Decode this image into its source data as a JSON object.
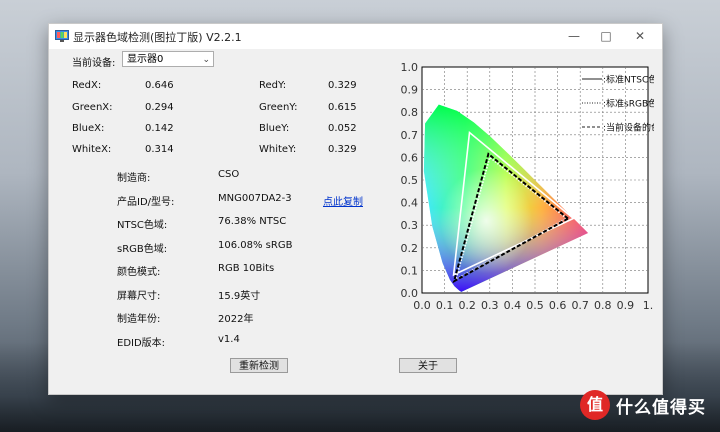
{
  "window": {
    "title": "显示器色域检测(图拉丁版) V2.2.1",
    "minimize_icon": "minimize-icon",
    "maximize_icon": "maximize-icon",
    "close_icon": "close-icon"
  },
  "device": {
    "label": "当前设备:",
    "selected": "显示器0"
  },
  "coords": {
    "redx_label": "RedX:",
    "redx": "0.646",
    "redy_label": "RedY:",
    "redy": "0.329",
    "greenx_label": "GreenX:",
    "greenx": "0.294",
    "greeny_label": "GreenY:",
    "greeny": "0.615",
    "bluex_label": "BlueX:",
    "bluex": "0.142",
    "bluey_label": "BlueY:",
    "bluey": "0.052",
    "whitex_label": "WhiteX:",
    "whitex": "0.314",
    "whitey_label": "WhiteY:",
    "whitey": "0.329"
  },
  "info": [
    {
      "label": "制造商:",
      "value": "CSO"
    },
    {
      "label": "产品ID/型号:",
      "value": "MNG007DA2-3"
    },
    {
      "label": "NTSC色域:",
      "value": "76.38% NTSC"
    },
    {
      "label": "sRGB色域:",
      "value": "106.08% sRGB"
    },
    {
      "label": "颜色模式:",
      "value": "RGB 10Bits"
    },
    {
      "label": "屏幕尺寸:",
      "value": "15.9英寸"
    },
    {
      "label": "制造年份:",
      "value": "2022年"
    },
    {
      "label": "EDID版本:",
      "value": "v1.4"
    }
  ],
  "copy_link": "点此复制",
  "buttons": {
    "redetect": "重新检测",
    "about": "关于"
  },
  "chart_data": {
    "type": "scatter",
    "xlim": [
      0.0,
      1.0
    ],
    "ylim": [
      0.0,
      1.0
    ],
    "x_ticks": [
      "0.0",
      "0.1",
      "0.2",
      "0.3",
      "0.4",
      "0.5",
      "0.6",
      "0.7",
      "0.8",
      "0.9",
      "1."
    ],
    "y_ticks": [
      "0.0",
      "0.1",
      "0.2",
      "0.3",
      "0.4",
      "0.5",
      "0.6",
      "0.7",
      "0.8",
      "0.9",
      "1.0"
    ],
    "grid": true,
    "legend_position": "top-right",
    "series": [
      {
        "name": "标准NTSC色彩范围",
        "style": "solid",
        "color": "#ffffff",
        "points": [
          [
            0.67,
            0.33
          ],
          [
            0.21,
            0.71
          ],
          [
            0.14,
            0.08
          ]
        ]
      },
      {
        "name": "标准sRGB色彩范围",
        "style": "dotted",
        "color": "#ffffff",
        "points": [
          [
            0.64,
            0.33
          ],
          [
            0.3,
            0.6
          ],
          [
            0.15,
            0.06
          ]
        ]
      },
      {
        "name": "当前设备的色彩范围",
        "style": "dashed",
        "color": "#000000",
        "points": [
          [
            0.646,
            0.329
          ],
          [
            0.294,
            0.615
          ],
          [
            0.142,
            0.052
          ]
        ]
      }
    ],
    "white_point": [
      0.314,
      0.329
    ]
  },
  "branding": {
    "logo_glyph": "值",
    "text": "什么值得买"
  }
}
